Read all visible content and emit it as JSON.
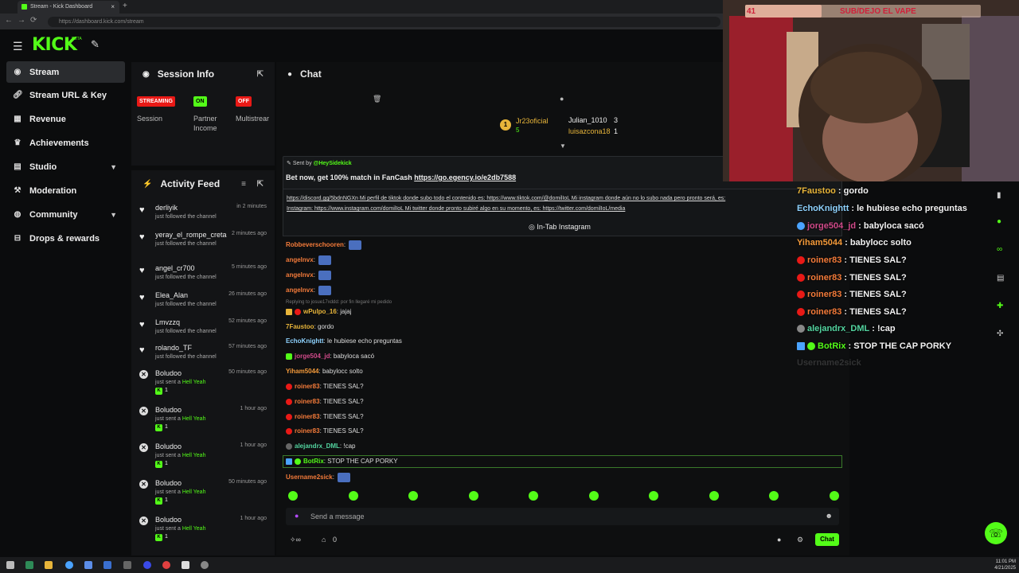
{
  "browser": {
    "tab_title": "Stream - Kick Dashboard",
    "url": "https://dashboard.kick.com/stream"
  },
  "header": {
    "logo": "KICK",
    "logo_sup": "BETA"
  },
  "sidebar": {
    "items": [
      {
        "label": "Stream",
        "icon": "broadcast-icon"
      },
      {
        "label": "Stream URL & Key",
        "icon": "link-icon"
      },
      {
        "label": "Revenue",
        "icon": "chart-icon"
      },
      {
        "label": "Achievements",
        "icon": "trophy-icon"
      },
      {
        "label": "Studio",
        "icon": "layers-icon"
      },
      {
        "label": "Moderation",
        "icon": "gavel-icon"
      },
      {
        "label": "Community",
        "icon": "globe-icon"
      },
      {
        "label": "Drops & rewards",
        "icon": "gift-icon"
      }
    ]
  },
  "session": {
    "title": "Session Info",
    "items": [
      {
        "badge": "STREAMING",
        "label": "Session",
        "color": "#e91916"
      },
      {
        "badge": "ON",
        "label": "Partner Income",
        "color": "#53fc18"
      },
      {
        "badge": "OFF",
        "label": "Multistrear",
        "color": "#e91916"
      }
    ]
  },
  "activity": {
    "title": "Activity Feed",
    "items": [
      {
        "name": "derliyik",
        "sub": "just followed the channel",
        "time": "in 2 minutes",
        "type": "follow"
      },
      {
        "name": "yeray_el_rompe_creta",
        "sub": "just followed the channel",
        "time": "2 minutes ago",
        "type": "follow"
      },
      {
        "name": "angel_cr700",
        "sub": "just followed the channel",
        "time": "5 minutes ago",
        "type": "follow"
      },
      {
        "name": "Elea_Alan",
        "sub": "just followed the channel",
        "time": "26 minutes ago",
        "type": "follow"
      },
      {
        "name": "Lmvzzq",
        "sub": "just followed the channel",
        "time": "52 minutes ago",
        "type": "follow"
      },
      {
        "name": "rolando_TF",
        "sub": "just followed the channel",
        "time": "57 minutes ago",
        "type": "follow"
      },
      {
        "name": "Boludoo",
        "sub": "just sent a",
        "hell": "Hell Yeah",
        "time": "50 minutes ago",
        "count": "1",
        "type": "gift"
      },
      {
        "name": "Boludoo",
        "sub": "just sent a",
        "hell": "Hell Yeah",
        "time": "1 hour ago",
        "count": "1",
        "type": "gift"
      },
      {
        "name": "Boludoo",
        "sub": "just sent a",
        "hell": "Hell Yeah",
        "time": "1 hour ago",
        "count": "1",
        "type": "gift"
      },
      {
        "name": "Boludoo",
        "sub": "just sent a",
        "hell": "Hell Yeah",
        "time": "50 minutes ago",
        "count": "1",
        "type": "gift"
      },
      {
        "name": "Boludoo",
        "sub": "just sent a",
        "hell": "Hell Yeah",
        "time": "1 hour ago",
        "count": "1",
        "type": "gift"
      }
    ]
  },
  "chat": {
    "title": "Chat",
    "leaders": [
      {
        "name": "Jr23oficial",
        "count": "5"
      },
      {
        "name": "Julian_1010",
        "count": "3"
      },
      {
        "name": "luisazcona18",
        "count": "1"
      }
    ],
    "sent_by_label": "Sent by",
    "sent_by_user": "@HeySidekick",
    "pinned_text": "Bet now, get 100% match in FanCash",
    "pinned_link": "https://go.egency.io/e2db7588",
    "promo_line1": "https://discord.gg/5bdnNGXn Mi perfil de tiktok donde subo todo el contenido es: https://www.tiktok.com/@domilIoL  Mi instagram donde aún no lo subo nada pero pronto será, es:",
    "promo_line2": "Instagram: https://www.instagram.com/domilIoL  Mi twitter donde pronto subiré algo en su momento, es: https://twitter.com/domilIoL/media",
    "instagram_btn": "In-Tab Instagram",
    "reply_text": "Replying to josue17xddd: por fin llegaré mi pedido",
    "messages": [
      {
        "user": "Robbeverschooren",
        "text": "",
        "color": "#f47b3a",
        "emote": true
      },
      {
        "user": "angelnvx",
        "text": "",
        "color": "#f47b3a",
        "emote": true
      },
      {
        "user": "angelnvx",
        "text": "",
        "color": "#f47b3a",
        "emote": true
      },
      {
        "user": "angelnvx",
        "text": "",
        "color": "#f47b3a",
        "emote": true
      },
      {
        "user": "wPulpo_16",
        "text": "jajaj",
        "color": "#e8b53a"
      },
      {
        "user": "7Faustoo",
        "text": "gordo",
        "color": "#e8b53a"
      },
      {
        "user": "EchoKnightt",
        "text": "le hubiese echo preguntas",
        "color": "#8fd3ff"
      },
      {
        "user": "jorge504_jd",
        "text": "babyloca sacó",
        "color": "#d14a8a"
      },
      {
        "user": "Yiham5044",
        "text": "babylocc solto",
        "color": "#f49a3a"
      },
      {
        "user": "roiner83",
        "text": "TIENES SAL?",
        "color": "#f47b3a"
      },
      {
        "user": "roiner83",
        "text": "TIENES SAL?",
        "color": "#f47b3a"
      },
      {
        "user": "roiner83",
        "text": "TIENES SAL?",
        "color": "#f47b3a"
      },
      {
        "user": "roiner83",
        "text": "TIENES SAL?",
        "color": "#f47b3a"
      },
      {
        "user": "alejandrx_DML",
        "text": "!cap",
        "color": "#53d4a0"
      },
      {
        "user": "BotRix",
        "text": "STOP THE CAP PORKY",
        "color": "#53fc18"
      },
      {
        "user": "Username2sick",
        "text": "",
        "color": "#f47b3a",
        "emote": true
      }
    ],
    "input_placeholder": "Send a message",
    "viewers": "0",
    "send_label": "Chat"
  },
  "overlay": {
    "banner_count": "41",
    "banner_text": "SUB/DEJO EL VAPE",
    "messages": [
      {
        "user": "7Faustoo",
        "text": "gordo",
        "color": "#e8b53a"
      },
      {
        "user": "EchoKnightt",
        "text": "le hubiese echo preguntas",
        "color": "#8fd3ff"
      },
      {
        "user": "jorge504_jd",
        "text": "babyloca sacó",
        "color": "#d14a8a"
      },
      {
        "user": "Yiham5044",
        "text": "babylocc solto",
        "color": "#f49a3a"
      },
      {
        "user": "roiner83",
        "text": "TIENES SAL?",
        "color": "#f47b3a"
      },
      {
        "user": "roiner83",
        "text": "TIENES SAL?",
        "color": "#f47b3a"
      },
      {
        "user": "roiner83",
        "text": "TIENES SAL?",
        "color": "#f47b3a"
      },
      {
        "user": "roiner83",
        "text": "TIENES SAL?",
        "color": "#f47b3a"
      },
      {
        "user": "alejandrx_DML",
        "text": "!cap",
        "color": "#53d4a0"
      },
      {
        "user": "BotRix",
        "text": "STOP THE CAP PORKY",
        "color": "#53fc18"
      },
      {
        "user": "Username2sick",
        "text": "",
        "color": "#777"
      }
    ]
  },
  "taskbar": {
    "time": "11:01 PM",
    "date": "4/21/2025"
  }
}
